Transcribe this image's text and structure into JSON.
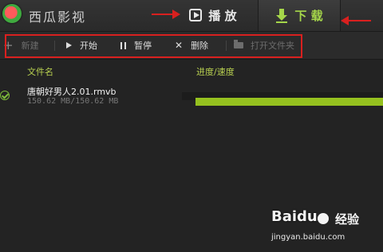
{
  "app": {
    "title": "西瓜影视"
  },
  "tabs": {
    "play_label": "播 放",
    "download_label": "下 载"
  },
  "toolbar": {
    "new_label": "新建",
    "start_label": "开始",
    "pause_label": "暂停",
    "delete_label": "删除",
    "open_folder_label": "打开文件夹"
  },
  "columns": {
    "filename": "文件名",
    "progress": "进度/速度"
  },
  "downloads": [
    {
      "name": "唐朝好男人2.01.rmvb",
      "size": "150.62 MB/150.62 MB",
      "progress": 1.0
    }
  ],
  "watermark": {
    "brand": "Baidu",
    "text": "经验",
    "url": "jingyan.baidu.com"
  },
  "colors": {
    "accent_green": "#95c11f",
    "annotation_red": "#d9201f",
    "background": "#232323"
  }
}
